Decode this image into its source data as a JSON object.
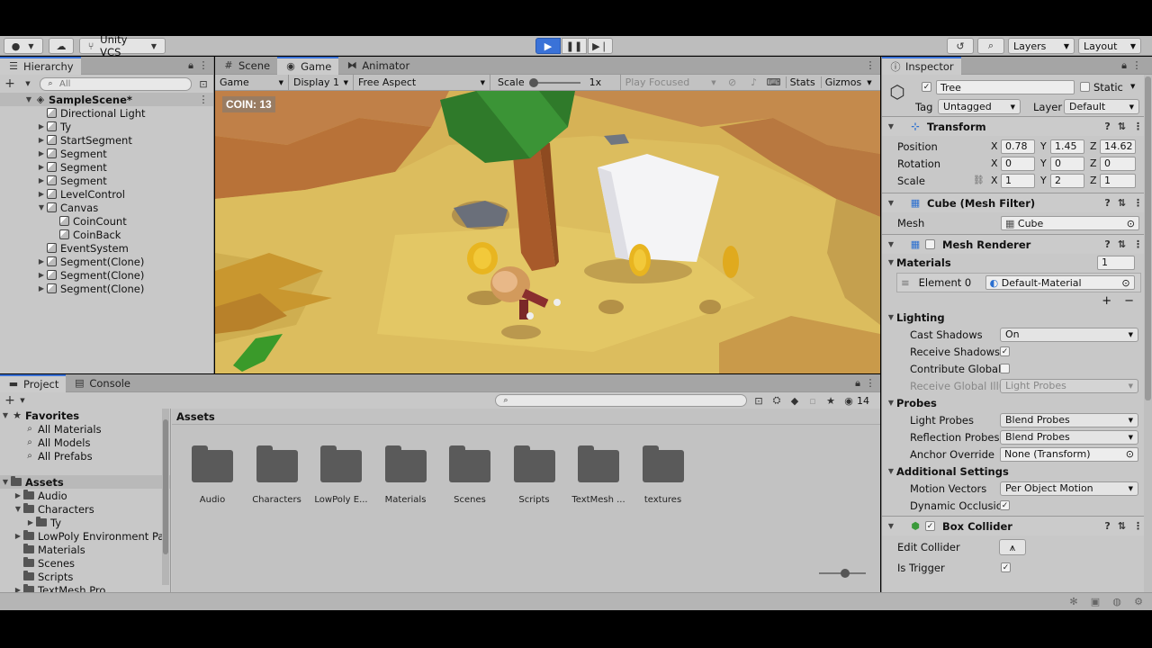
{
  "toolbar": {
    "vcs_label": "Unity VCS",
    "layers_label": "Layers",
    "layout_label": "Layout"
  },
  "hierarchy": {
    "tab_label": "Hierarchy",
    "search_placeholder": "All",
    "scene_name": "SampleScene*",
    "items": [
      {
        "label": "Directional Light",
        "indent": 1,
        "expander": ""
      },
      {
        "label": "Ty",
        "indent": 1,
        "expander": "▶"
      },
      {
        "label": "StartSegment",
        "indent": 1,
        "expander": "▶"
      },
      {
        "label": "Segment",
        "indent": 1,
        "expander": "▶"
      },
      {
        "label": "Segment",
        "indent": 1,
        "expander": "▶"
      },
      {
        "label": "Segment",
        "indent": 1,
        "expander": "▶"
      },
      {
        "label": "LevelControl",
        "indent": 1,
        "expander": "▶"
      },
      {
        "label": "Canvas",
        "indent": 1,
        "expander": "▼"
      },
      {
        "label": "CoinCount",
        "indent": 2,
        "expander": ""
      },
      {
        "label": "CoinBack",
        "indent": 2,
        "expander": ""
      },
      {
        "label": "EventSystem",
        "indent": 1,
        "expander": ""
      },
      {
        "label": "Segment(Clone)",
        "indent": 1,
        "expander": "▶"
      },
      {
        "label": "Segment(Clone)",
        "indent": 1,
        "expander": "▶"
      },
      {
        "label": "Segment(Clone)",
        "indent": 1,
        "expander": "▶"
      }
    ]
  },
  "game_view": {
    "tabs": [
      "Scene",
      "Game",
      "Animator"
    ],
    "mode": "Game",
    "display": "Display 1",
    "aspect": "Free Aspect",
    "scale_label": "Scale",
    "scale_value": "1x",
    "play_focused": "Play Focused",
    "stats": "Stats",
    "gizmos": "Gizmos",
    "coin_text": "COIN: 13"
  },
  "project": {
    "tabs": [
      "Project",
      "Console"
    ],
    "hidden_count": "14",
    "favorites_label": "Favorites",
    "favorites": [
      "All Materials",
      "All Models",
      "All Prefabs"
    ],
    "assets_label": "Assets",
    "asset_tree": [
      {
        "label": "Audio",
        "indent": 1,
        "expander": "▶"
      },
      {
        "label": "Characters",
        "indent": 1,
        "expander": "▼"
      },
      {
        "label": "Ty",
        "indent": 2,
        "expander": "▶"
      },
      {
        "label": "LowPoly Environment Pac",
        "indent": 1,
        "expander": "▶"
      },
      {
        "label": "Materials",
        "indent": 1,
        "expander": ""
      },
      {
        "label": "Scenes",
        "indent": 1,
        "expander": ""
      },
      {
        "label": "Scripts",
        "indent": 1,
        "expander": ""
      },
      {
        "label": "TextMesh Pro",
        "indent": 1,
        "expander": "▶"
      }
    ],
    "breadcrumb": "Assets",
    "folders": [
      "Audio",
      "Characters",
      "LowPoly E...",
      "Materials",
      "Scenes",
      "Scripts",
      "TextMesh ...",
      "textures"
    ]
  },
  "inspector": {
    "tab_label": "Inspector",
    "object_name": "Tree",
    "static_label": "Static",
    "tag_label": "Tag",
    "tag_value": "Untagged",
    "layer_label": "Layer",
    "layer_value": "Default",
    "transform": {
      "title": "Transform",
      "position_label": "Position",
      "rotation_label": "Rotation",
      "scale_label": "Scale",
      "position": {
        "x": "0.78",
        "y": "1.45",
        "z": "14.62"
      },
      "rotation": {
        "x": "0",
        "y": "0",
        "z": "0"
      },
      "scale": {
        "x": "1",
        "y": "2",
        "z": "1"
      }
    },
    "mesh_filter": {
      "title": "Cube (Mesh Filter)",
      "mesh_label": "Mesh",
      "mesh_value": "Cube"
    },
    "mesh_renderer": {
      "title": "Mesh Renderer",
      "materials_label": "Materials",
      "materials_count": "1",
      "element_label": "Element 0",
      "element_value": "Default-Material",
      "lighting_label": "Lighting",
      "cast_shadows_label": "Cast Shadows",
      "cast_shadows_value": "On",
      "receive_shadows_label": "Receive Shadows",
      "contribute_gi_label": "Contribute Global I",
      "receive_gi_label": "Receive Global Illu",
      "receive_gi_value": "Light Probes",
      "probes_label": "Probes",
      "light_probes_label": "Light Probes",
      "light_probes_value": "Blend Probes",
      "reflection_probes_label": "Reflection Probes",
      "reflection_probes_value": "Blend Probes",
      "anchor_override_label": "Anchor Override",
      "anchor_override_value": "None (Transform)",
      "additional_label": "Additional Settings",
      "motion_vectors_label": "Motion Vectors",
      "motion_vectors_value": "Per Object Motion",
      "dynamic_occlusion_label": "Dynamic Occlusio"
    },
    "box_collider": {
      "title": "Box Collider",
      "edit_collider_label": "Edit Collider",
      "is_trigger_label": "Is Trigger"
    }
  },
  "colors": {
    "accent": "#3a72d8",
    "panel": "#c8c8c8",
    "tabbar": "#a5a5a5",
    "sand": "#d9b95a"
  }
}
